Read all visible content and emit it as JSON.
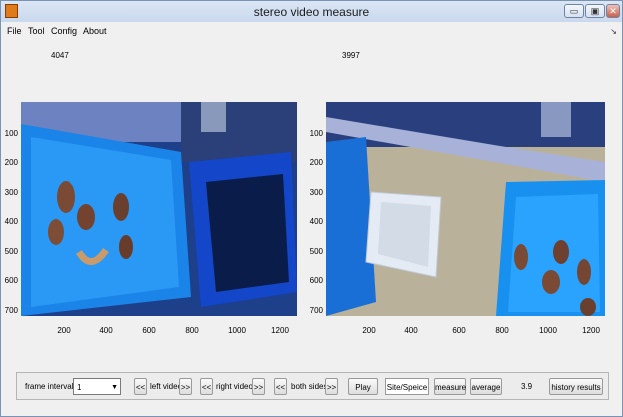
{
  "window": {
    "title": "stereo video measure"
  },
  "window_controls": {
    "minimize": "▭",
    "maximize": "▣",
    "close": "✕"
  },
  "menu": {
    "items": [
      "File",
      "Tool",
      "Config",
      "About"
    ]
  },
  "left_video": {
    "frame_number": "4047",
    "y_ticks": [
      "100",
      "200",
      "300",
      "400",
      "500",
      "600",
      "700"
    ],
    "x_ticks": [
      "200",
      "400",
      "600",
      "800",
      "1000",
      "1200"
    ]
  },
  "right_video": {
    "frame_number": "3997",
    "y_ticks": [
      "100",
      "200",
      "300",
      "400",
      "500",
      "600",
      "700"
    ],
    "x_ticks": [
      "200",
      "400",
      "600",
      "800",
      "1000",
      "1200"
    ]
  },
  "controls": {
    "frame_interval_label": "frame interval:",
    "frame_interval_value": "1",
    "prev": "<<",
    "next": ">>",
    "left_video_label": "left video",
    "right_video_label": "right video",
    "both_sides_label": "both sides",
    "play": "Play",
    "site_species": "Site/Speice",
    "measure": "measure",
    "average": "average",
    "value": "3.9",
    "history_results": "history results"
  }
}
